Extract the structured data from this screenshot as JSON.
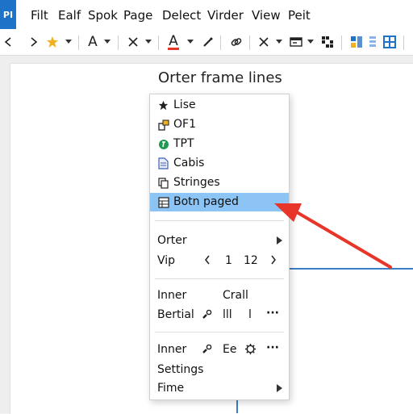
{
  "app": {
    "badge": "PI"
  },
  "menubar": {
    "items": [
      "Filt",
      "Ealf",
      "Spok",
      "Page",
      "Delect",
      "Virder",
      "View",
      "Peit"
    ]
  },
  "toolbar": {
    "font_label": "A",
    "font_color_label": "A",
    "font_color_underline": "#e8352a",
    "star_color": "#f2b21d",
    "accent": "#1e73c8"
  },
  "page": {
    "title": "Orter frame lines"
  },
  "context_menu": {
    "items": [
      {
        "label": "Lise",
        "icon": "star-icon"
      },
      {
        "label": "OF1",
        "icon": "frame-icon"
      },
      {
        "label": "TPT",
        "icon": "green-circle-icon"
      },
      {
        "label": "Cabis",
        "icon": "document-icon"
      },
      {
        "label": "Stringes",
        "icon": "copy-icon"
      },
      {
        "label": "Botn paged",
        "icon": "table-icon",
        "highlighted": true
      }
    ],
    "orter": {
      "label": "Orter"
    },
    "vip": {
      "label": "Vip",
      "value_1": "1",
      "value_2": "12"
    },
    "inner1": {
      "label": "Inner",
      "extra": "Crall"
    },
    "bertial": {
      "label": "Bertial",
      "b1": "lll",
      "b2": "l",
      "more": "···"
    },
    "inner2": {
      "label": "Inner",
      "ee": "Ee",
      "more": "···"
    },
    "settings": {
      "label": "Settings"
    },
    "fime": {
      "label": "Fime"
    },
    "highlight_color": "#8cc4f5"
  },
  "annotation": {
    "arrow_color": "#e8352a"
  },
  "lines_color": "#3b7dc7"
}
